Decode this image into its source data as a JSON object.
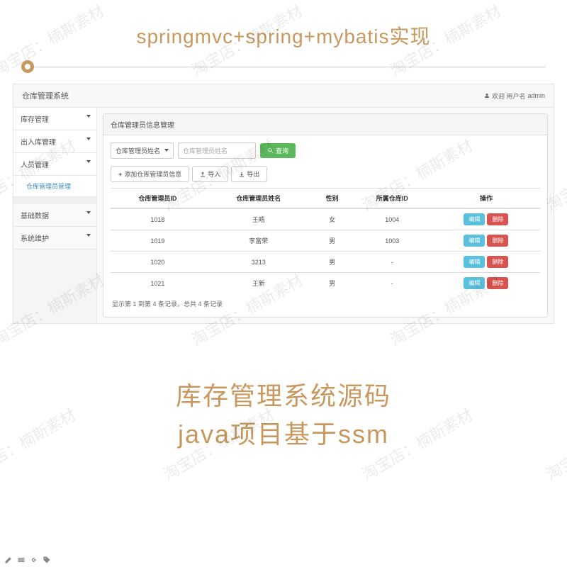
{
  "top_title": "springmvc+spring+mybatis实现",
  "bottom_text_line1": "库存管理系统源码",
  "bottom_text_line2": "java项目基于ssm",
  "watermark": "淘宝店：楠斯素材",
  "app": {
    "brand": "仓库管理系统",
    "welcome_prefix": "欢迎 用户名",
    "welcome_user": "admin",
    "sidebar": {
      "items": [
        {
          "label": "库存管理",
          "has_caret": true
        },
        {
          "label": "出入库管理",
          "has_caret": true
        },
        {
          "label": "人员管理",
          "has_caret": true
        }
      ],
      "sub_item": "仓库管理员管理",
      "items2": [
        {
          "label": "基础数据",
          "has_caret": true
        },
        {
          "label": "系统维护",
          "has_caret": true
        }
      ]
    },
    "panel_title": "仓库管理员信息管理",
    "search": {
      "select_label": "仓库管理员姓名",
      "placeholder": "仓库管理员姓名",
      "button": "查询"
    },
    "toolbar": {
      "add": "添加仓库管理员信息",
      "import": "导入",
      "export": "导出"
    },
    "table": {
      "headers": [
        "仓库管理员ID",
        "仓库管理员姓名",
        "性别",
        "所属仓库ID",
        "操作"
      ],
      "rows": [
        {
          "id": "1018",
          "name": "王皓",
          "gender": "女",
          "wh": "1004"
        },
        {
          "id": "1019",
          "name": "李富荣",
          "gender": "男",
          "wh": "1003"
        },
        {
          "id": "1020",
          "name": "3213",
          "gender": "男",
          "wh": "-"
        },
        {
          "id": "1021",
          "name": "王新",
          "gender": "男",
          "wh": "-"
        }
      ],
      "action_edit": "编辑",
      "action_delete": "删除",
      "footer": "显示第 1 到第 4 条记录，总共 4 条记录"
    }
  }
}
